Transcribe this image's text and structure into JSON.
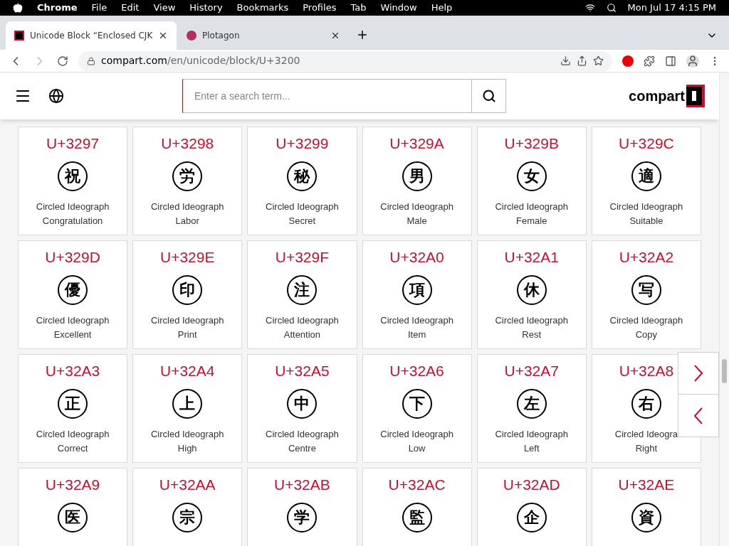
{
  "menu_bar": {
    "app": "Chrome",
    "items": [
      "File",
      "Edit",
      "View",
      "History",
      "Bookmarks",
      "Profiles",
      "Tab",
      "Window",
      "Help"
    ],
    "clock": "Mon Jul 17  4:15 PM"
  },
  "tabs": [
    {
      "title": "Unicode Block “Enclosed CJK",
      "selected": true
    },
    {
      "title": "Plotagon",
      "selected": false
    }
  ],
  "address_bar": {
    "domain": "compart.com",
    "path": "/en/unicode/block/U+3200"
  },
  "header": {
    "search": {
      "placeholder": "Enter a search term..."
    },
    "logo": "compart"
  },
  "cards": [
    {
      "code": "U+3297",
      "glyph": "祝",
      "name": "Circled Ideograph",
      "meaning": "Congratulation"
    },
    {
      "code": "U+3298",
      "glyph": "労",
      "name": "Circled Ideograph",
      "meaning": "Labor"
    },
    {
      "code": "U+3299",
      "glyph": "秘",
      "name": "Circled Ideograph",
      "meaning": "Secret"
    },
    {
      "code": "U+329A",
      "glyph": "男",
      "name": "Circled Ideograph",
      "meaning": "Male"
    },
    {
      "code": "U+329B",
      "glyph": "女",
      "name": "Circled Ideograph",
      "meaning": "Female"
    },
    {
      "code": "U+329C",
      "glyph": "適",
      "name": "Circled Ideograph",
      "meaning": "Suitable"
    },
    {
      "code": "U+329D",
      "glyph": "優",
      "name": "Circled Ideograph",
      "meaning": "Excellent"
    },
    {
      "code": "U+329E",
      "glyph": "印",
      "name": "Circled Ideograph",
      "meaning": "Print"
    },
    {
      "code": "U+329F",
      "glyph": "注",
      "name": "Circled Ideograph",
      "meaning": "Attention"
    },
    {
      "code": "U+32A0",
      "glyph": "項",
      "name": "Circled Ideograph",
      "meaning": "Item"
    },
    {
      "code": "U+32A1",
      "glyph": "休",
      "name": "Circled Ideograph",
      "meaning": "Rest"
    },
    {
      "code": "U+32A2",
      "glyph": "写",
      "name": "Circled Ideograph",
      "meaning": "Copy"
    },
    {
      "code": "U+32A3",
      "glyph": "正",
      "name": "Circled Ideograph",
      "meaning": "Correct"
    },
    {
      "code": "U+32A4",
      "glyph": "上",
      "name": "Circled Ideograph",
      "meaning": "High"
    },
    {
      "code": "U+32A5",
      "glyph": "中",
      "name": "Circled Ideograph",
      "meaning": "Centre"
    },
    {
      "code": "U+32A6",
      "glyph": "下",
      "name": "Circled Ideograph",
      "meaning": "Low"
    },
    {
      "code": "U+32A7",
      "glyph": "左",
      "name": "Circled Ideograph",
      "meaning": "Left"
    },
    {
      "code": "U+32A8",
      "glyph": "右",
      "name": "Circled Ideogra",
      "meaning": "Right"
    },
    {
      "code": "U+32A9",
      "glyph": "医"
    },
    {
      "code": "U+32AA",
      "glyph": "宗"
    },
    {
      "code": "U+32AB",
      "glyph": "学"
    },
    {
      "code": "U+32AC",
      "glyph": "監"
    },
    {
      "code": "U+32AD",
      "glyph": "企"
    },
    {
      "code": "U+32AE",
      "glyph": "資"
    }
  ]
}
